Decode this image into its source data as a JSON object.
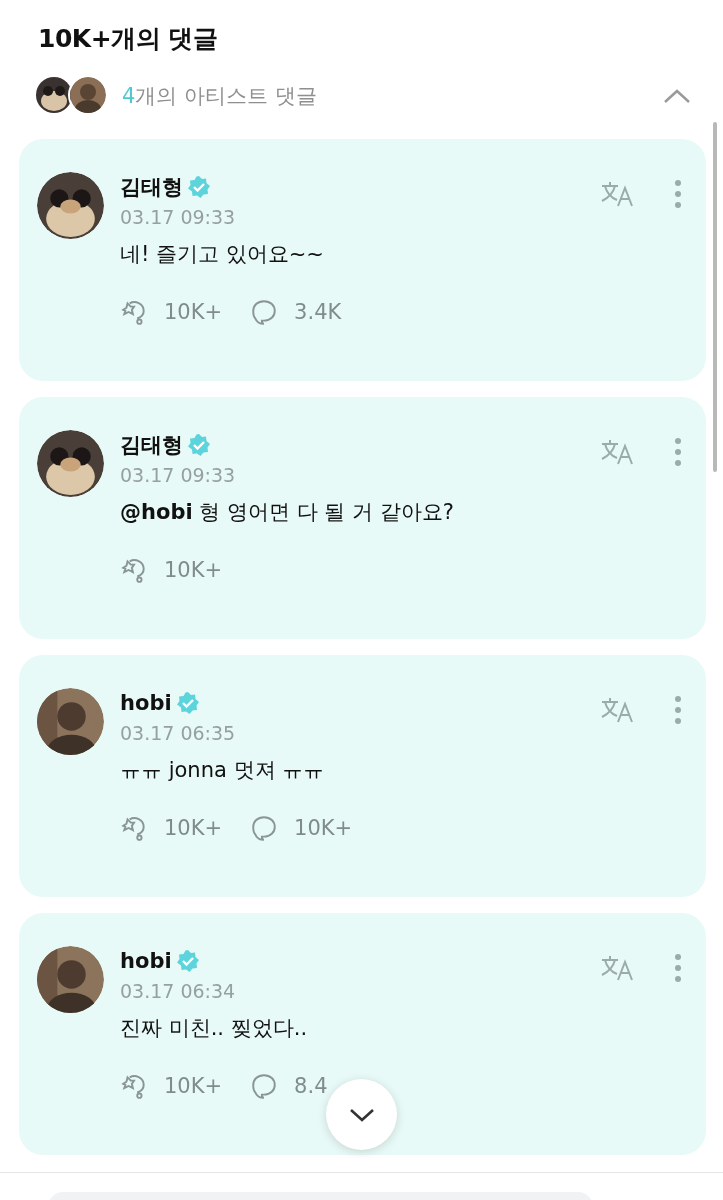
{
  "header": {
    "title": "10K+개의 댓글"
  },
  "artist_bar": {
    "count": "4",
    "label": "개의 아티스트 댓글",
    "expanded": true
  },
  "comments": [
    {
      "author": "김태형",
      "verified": true,
      "time": "03.17 09:33",
      "text": "네! 즐기고 있어요~~",
      "likes": "10K+",
      "replies": "3.4K"
    },
    {
      "author": "김태형",
      "verified": true,
      "time": "03.17 09:33",
      "text": "**@hobi** 형 영어면 다 될 거 같아요?",
      "likes": "10K+"
    },
    {
      "author": "hobi",
      "verified": true,
      "time": "03.17 06:35",
      "text": "ㅠㅠ jonna 멋져 ㅠㅠ",
      "likes": "10K+",
      "replies": "10K+"
    },
    {
      "author": "hobi",
      "verified": true,
      "time": "03.17 06:34",
      "text": "진짜 미친.. 찢었다..",
      "likes": "10K+",
      "replies": "8.4"
    }
  ]
}
